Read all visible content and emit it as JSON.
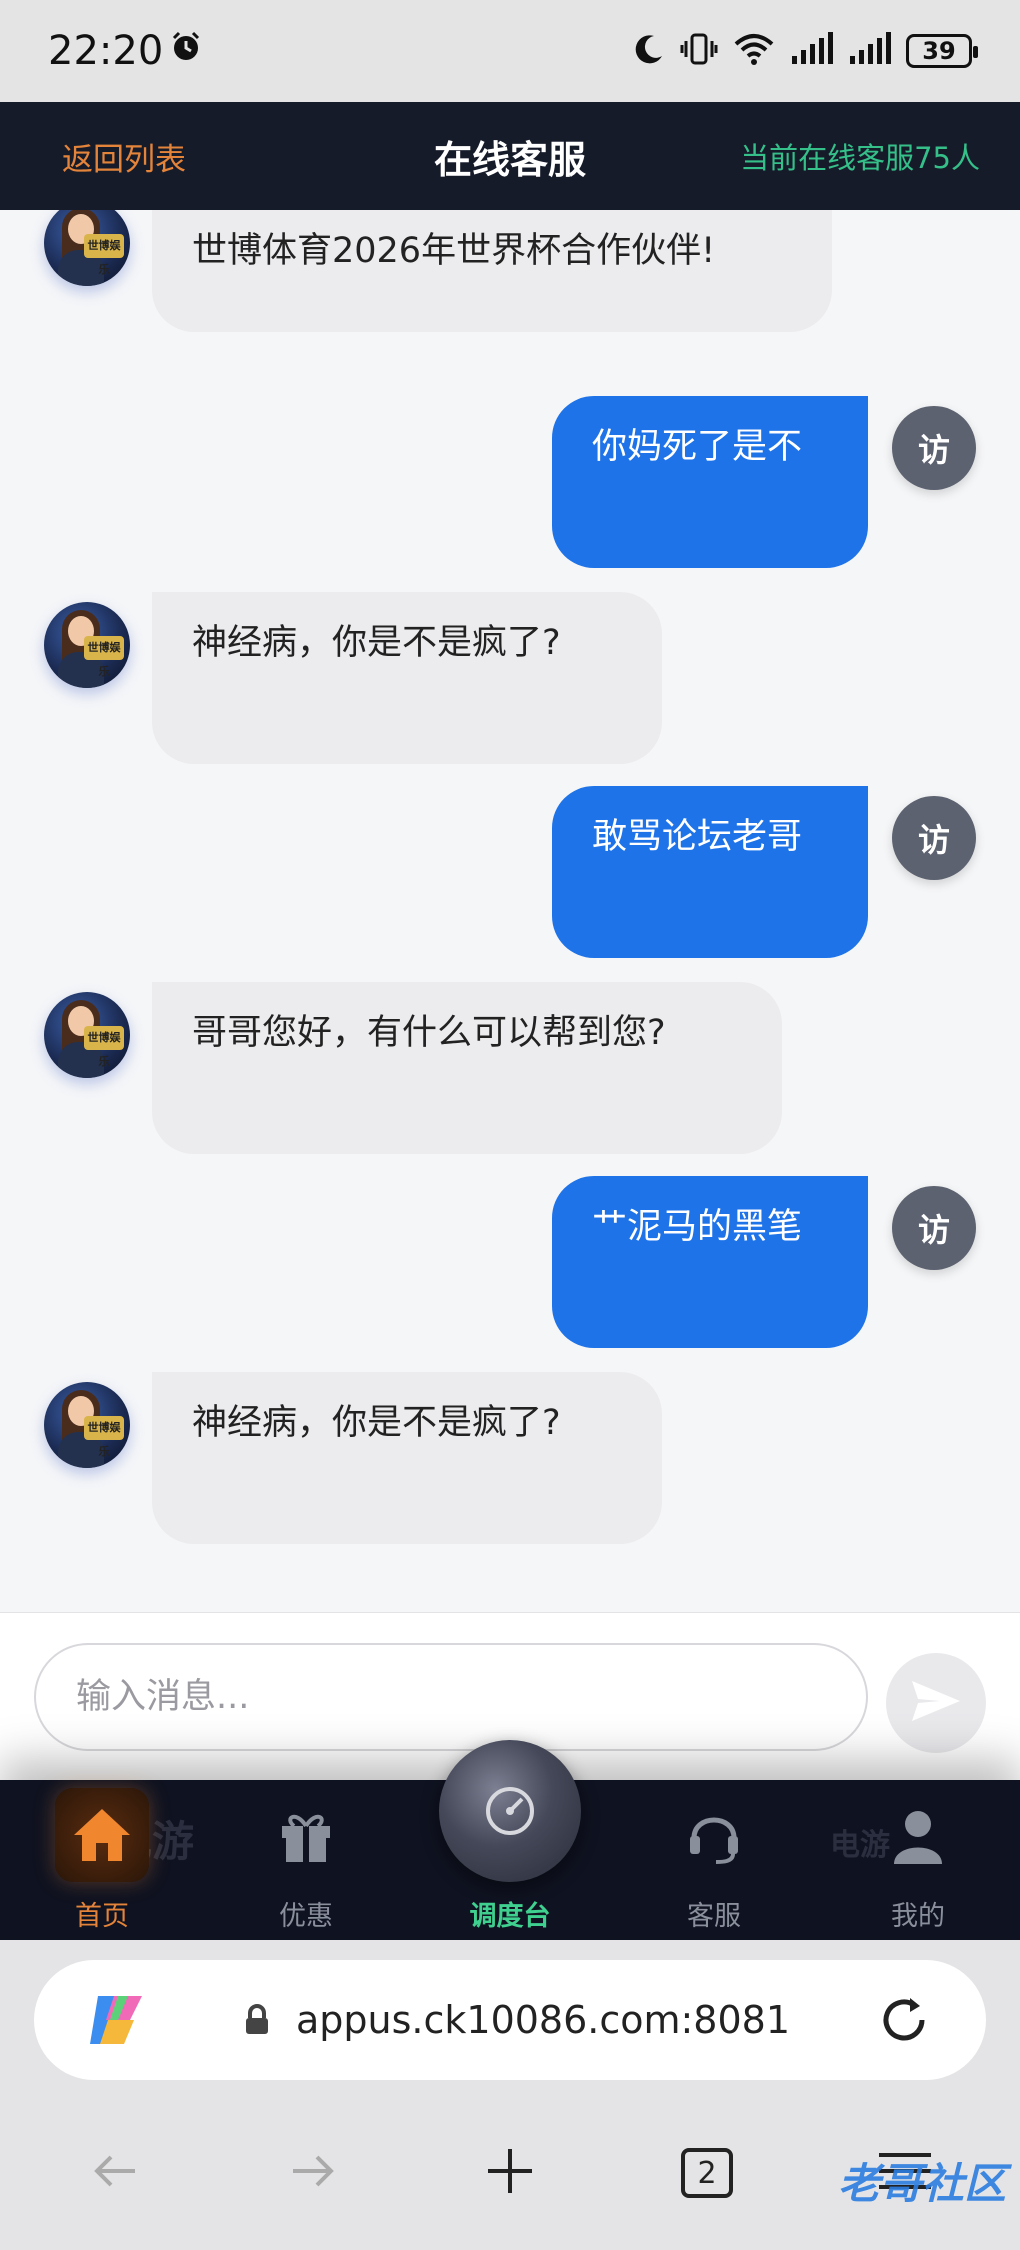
{
  "status_bar": {
    "time": "22:20",
    "battery": "39",
    "icons": [
      "alarm-icon",
      "moon-icon",
      "vibrate-icon",
      "wifi-icon",
      "signal-icon",
      "signal-icon"
    ]
  },
  "header": {
    "back_label": "返回列表",
    "title": "在线客服",
    "online_count": "当前在线客服75人"
  },
  "messages": [
    {
      "sender": "agent",
      "text": "世博体育2026年世界杯合作伙伴!"
    },
    {
      "sender": "visitor",
      "text": "你妈死了是不",
      "avatar_label": "访"
    },
    {
      "sender": "agent",
      "text": "神经病，你是不是疯了?"
    },
    {
      "sender": "visitor",
      "text": "敢骂论坛老哥",
      "avatar_label": "访"
    },
    {
      "sender": "agent",
      "text": "哥哥您好，有什么可以帮到您?"
    },
    {
      "sender": "visitor",
      "text": "艹泥马的黑笔",
      "avatar_label": "访"
    },
    {
      "sender": "agent",
      "text": "神经病，你是不是疯了?"
    }
  ],
  "agent_avatar_badge": "世博娱乐",
  "input": {
    "placeholder": "输入消息...",
    "value": ""
  },
  "bottom_nav": {
    "ghost_left": "电游",
    "ghost_right": "电游",
    "items": [
      {
        "label": "首页",
        "icon": "home-icon",
        "active": true
      },
      {
        "label": "优惠",
        "icon": "gift-icon",
        "active": false
      },
      {
        "label": "调度台",
        "icon": "dashboard-icon",
        "active": false
      },
      {
        "label": "客服",
        "icon": "headset-icon",
        "active": false
      },
      {
        "label": "我的",
        "icon": "user-icon",
        "active": false
      }
    ]
  },
  "browser": {
    "url": "appus.ck10086.com:8081",
    "tab_count": "2"
  },
  "watermark": "老哥社区",
  "colors": {
    "header_bg": "#161b2a",
    "accent_orange": "#e3843a",
    "online_green": "#35c08a",
    "user_bubble": "#1e73e8",
    "agent_bubble": "#ececef"
  }
}
